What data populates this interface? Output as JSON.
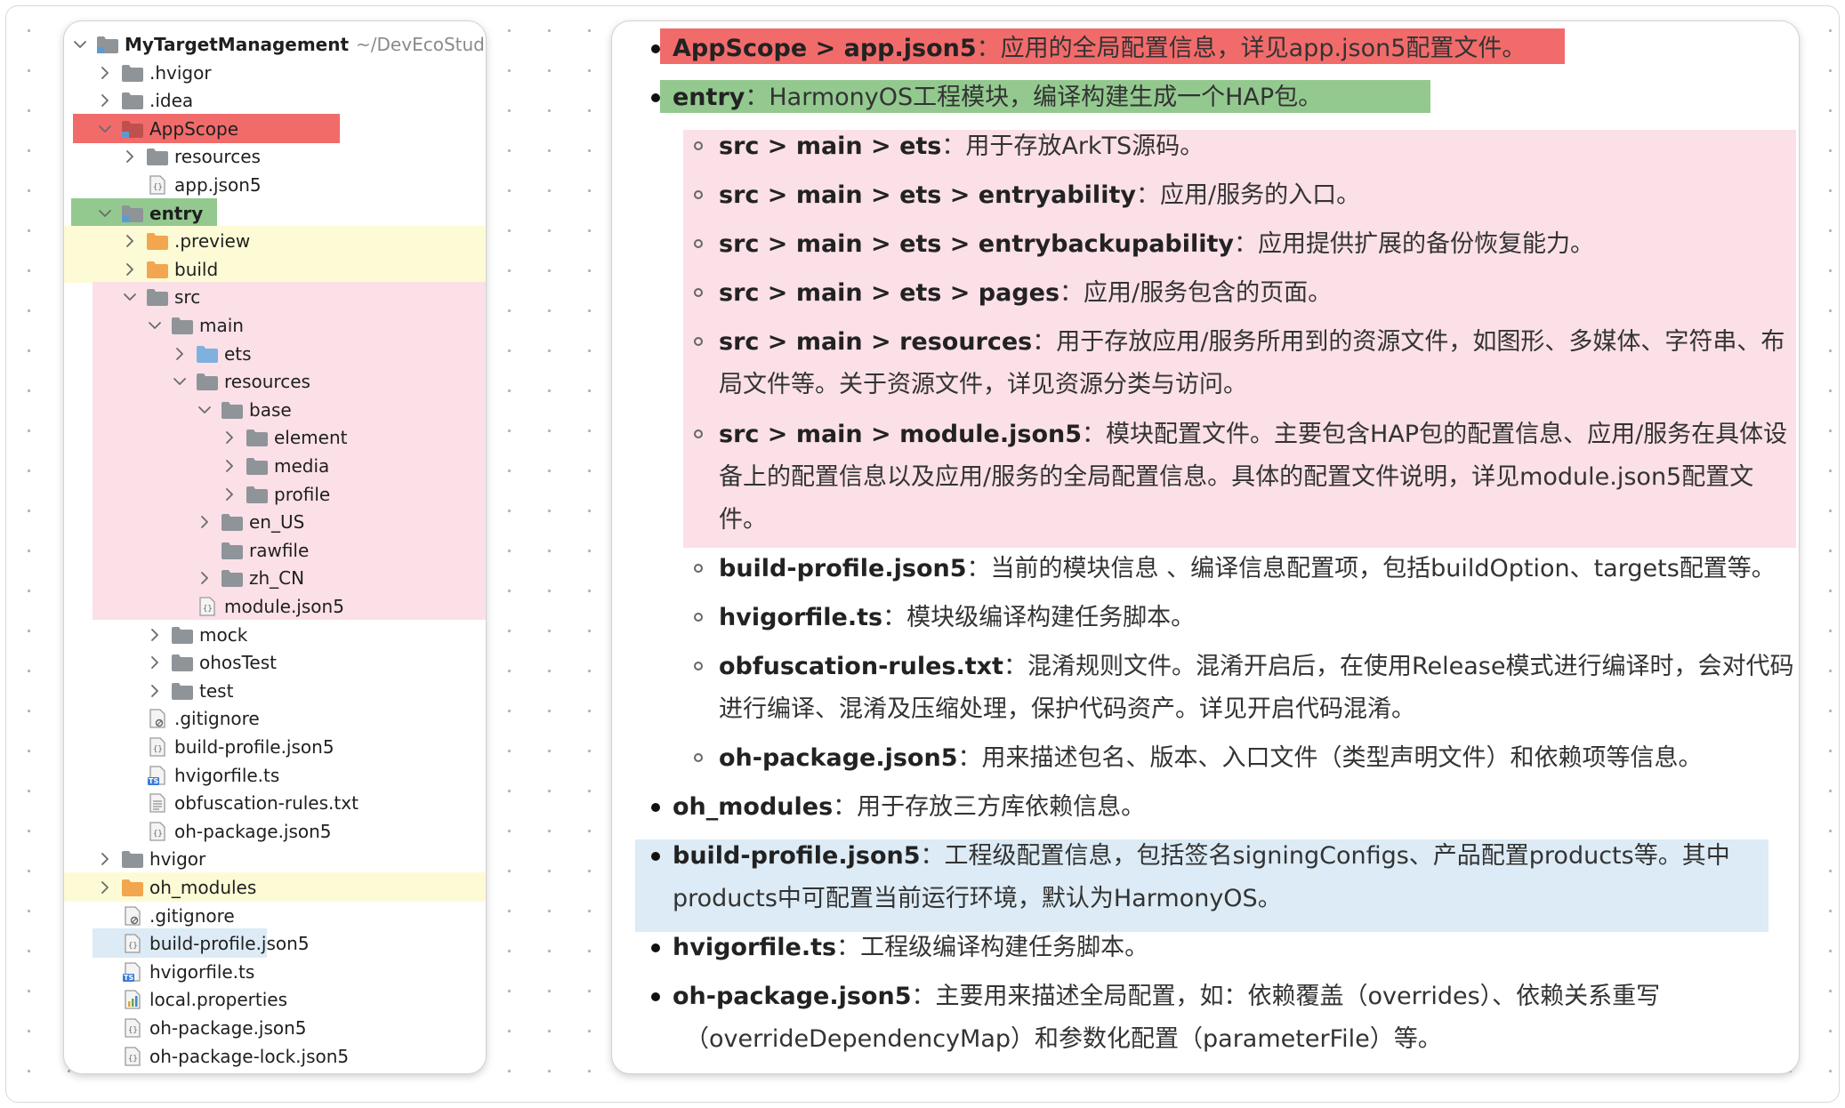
{
  "tree": {
    "root": {
      "label": "MyTargetManagement",
      "path": "~/DevEcoStudioPro"
    },
    "items": [
      {
        "label": ".hvigor"
      },
      {
        "label": ".idea"
      },
      {
        "label": "AppScope"
      },
      {
        "label": "resources"
      },
      {
        "label": "app.json5"
      },
      {
        "label": "entry"
      },
      {
        "label": ".preview"
      },
      {
        "label": "build"
      },
      {
        "label": "src"
      },
      {
        "label": "main"
      },
      {
        "label": "ets"
      },
      {
        "label": "resources"
      },
      {
        "label": "base"
      },
      {
        "label": "element"
      },
      {
        "label": "media"
      },
      {
        "label": "profile"
      },
      {
        "label": "en_US"
      },
      {
        "label": "rawfile"
      },
      {
        "label": "zh_CN"
      },
      {
        "label": "module.json5"
      },
      {
        "label": "mock"
      },
      {
        "label": "ohosTest"
      },
      {
        "label": "test"
      },
      {
        "label": ".gitignore"
      },
      {
        "label": "build-profile.json5"
      },
      {
        "label": "hvigorfile.ts"
      },
      {
        "label": "obfuscation-rules.txt"
      },
      {
        "label": "oh-package.json5"
      },
      {
        "label": "hvigor"
      },
      {
        "label": "oh_modules"
      },
      {
        "label": ".gitignore"
      },
      {
        "label": "build-profile.json5"
      },
      {
        "label": "hvigorfile.ts"
      },
      {
        "label": "local.properties"
      },
      {
        "label": "oh-package.json5"
      },
      {
        "label": "oh-package-lock.json5"
      }
    ]
  },
  "doc": {
    "lines": [
      {
        "key": "AppScope > app.json5",
        "text": "：应用的全局配置信息，详见app.json5配置文件。"
      },
      {
        "key": "entry",
        "text": "：HarmonyOS工程模块，编译构建生成一个HAP包。"
      },
      {
        "key": "src > main > ets",
        "text": "：用于存放ArkTS源码。"
      },
      {
        "key": "src > main > ets > entryability",
        "text": "：应用/服务的入口。"
      },
      {
        "key": "src > main > ets > entrybackupability",
        "text": "：应用提供扩展的备份恢复能力。"
      },
      {
        "key": "src > main > ets > pages",
        "text": "：应用/服务包含的页面。"
      },
      {
        "key": "src > main > resources",
        "text": "：用于存放应用/服务所用到的资源文件，如图形、多媒体、字符串、布"
      },
      {
        "key": "",
        "text": "局文件等。关于资源文件，详见资源分类与访问。"
      },
      {
        "key": "src > main > module.json5",
        "text": "：模块配置文件。主要包含HAP包的配置信息、应用/服务在具体设"
      },
      {
        "key": "",
        "text": "备上的配置信息以及应用/服务的全局配置信息。具体的配置文件说明，详见module.json5配置文"
      },
      {
        "key": "",
        "text": "件。"
      },
      {
        "key": "build-profile.json5",
        "text": "：当前的模块信息 、编译信息配置项，包括buildOption、targets配置等。"
      },
      {
        "key": "hvigorfile.ts",
        "text": "：模块级编译构建任务脚本。"
      },
      {
        "key": "obfuscation-rules.txt",
        "text": "：混淆规则文件。混淆开启后，在使用Release模式进行编译时，会对代码"
      },
      {
        "key": "",
        "text": "进行编译、混淆及压缩处理，保护代码资产。详见开启代码混淆。"
      },
      {
        "key": "oh-package.json5",
        "text": "：用来描述包名、版本、入口文件（类型声明文件）和依赖项等信息。"
      },
      {
        "key": "oh_modules",
        "text": "：用于存放三方库依赖信息。"
      },
      {
        "key": "build-profile.json5",
        "text": "：工程级配置信息，包括签名signingConfigs、产品配置products等。其中"
      },
      {
        "key": "",
        "text": "products中可配置当前运行环境，默认为HarmonyOS。"
      },
      {
        "key": "hvigorfile.ts",
        "text": "：工程级编译构建任务脚本。"
      },
      {
        "key": "oh-package.json5",
        "text": "：主要用来描述全局配置，如：依赖覆盖（overrides）、依赖关系重写"
      },
      {
        "key": "",
        "text": "（overrideDependencyMap）和参数化配置（parameterFile）等。"
      }
    ]
  },
  "colors": {
    "appscope_red": "#f26b6b",
    "entry_green": "#93c98f",
    "preview_yellow": "#fdfbd5",
    "src_pink": "#fbe0e7",
    "selected_blue": "#dcebf5",
    "folder_grey": "#8f9499",
    "folder_blue": "#7fb1df",
    "folder_orange": "#f2a64f",
    "module_blue": "#5b9bd5"
  }
}
